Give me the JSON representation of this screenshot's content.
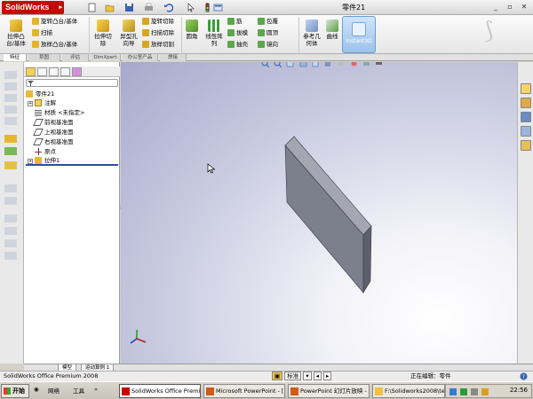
{
  "app": {
    "logo_text": "SolidWorks",
    "document_title": "零件21"
  },
  "window_controls": {
    "minimize": "_",
    "restore": "▫",
    "close": "✕"
  },
  "ribbon": {
    "features_group": {
      "extrude_boss": "拉伸凸\n台/基体",
      "revolve_boss": "旋转凸台/基体",
      "sweep": "扫描",
      "loft_boss": "放样凸台/基体",
      "extrude_cut": "拉伸切\n除",
      "hole_wizard": "异型孔\n向导",
      "revolve_cut": "旋转切除",
      "swept_cut": "扫描切除",
      "lofted_cut": "放样切割",
      "fillet": "圆角",
      "linear_pattern": "线性阵\n列",
      "rib": "筋",
      "draft": "拔模",
      "shell": "抽壳",
      "wrap": "包覆",
      "dome": "圆顶",
      "mirror": "镜向",
      "ref_geometry": "参考几\n何体",
      "curves": "曲线",
      "instant3d": "Instant3D"
    }
  },
  "tabs": [
    "特征",
    "草图",
    "评估",
    "DimXpert",
    "办公室产品",
    "焊接"
  ],
  "feature_tree": {
    "root": "零件21",
    "items": [
      {
        "label": "注解"
      },
      {
        "label": "材质 <未指定>"
      },
      {
        "label": "前视基准面"
      },
      {
        "label": "上视基准面"
      },
      {
        "label": "右视基准面"
      },
      {
        "label": "原点"
      },
      {
        "label": "拉伸1"
      }
    ]
  },
  "model_tabs": [
    "模型",
    "运动算例 1"
  ],
  "status": {
    "app_name": "SolidWorks Office Premium 2008",
    "view_label": "标准",
    "editing": "正在编辑：零件"
  },
  "taskbar": {
    "start": "开始",
    "network": "网络",
    "tools": "工具",
    "more": "»",
    "buttons": [
      {
        "label": "SolidWorks Office Premi...",
        "active": true
      },
      {
        "label": "Microsoft PowerPoint - [...",
        "active": false
      },
      {
        "label": "PowerPoint 幻灯片放映 - ...",
        "active": false
      },
      {
        "label": "F:\\Solidworks2008\\temp...",
        "active": false
      }
    ],
    "clock": "22:56"
  },
  "colors": {
    "sw_red": "#cc0000",
    "part_face_front": "#7c7f8c",
    "part_face_side": "#5d606c",
    "part_face_top": "#a4a7b2",
    "rollback": "#2d4f9c"
  }
}
